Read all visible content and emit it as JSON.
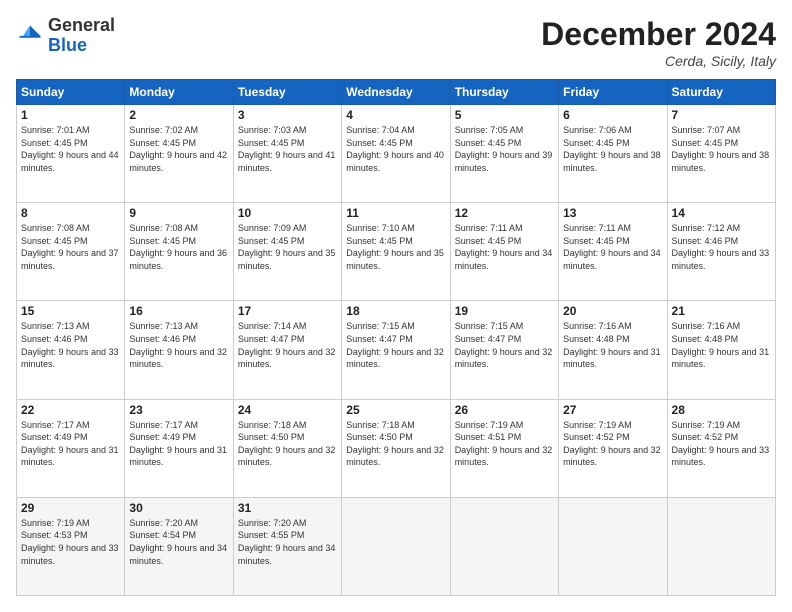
{
  "header": {
    "logo": {
      "general": "General",
      "blue": "Blue"
    },
    "title": "December 2024",
    "location": "Cerda, Sicily, Italy"
  },
  "weekdays": [
    "Sunday",
    "Monday",
    "Tuesday",
    "Wednesday",
    "Thursday",
    "Friday",
    "Saturday"
  ],
  "weeks": [
    [
      {
        "day": "1",
        "sunrise": "Sunrise: 7:01 AM",
        "sunset": "Sunset: 4:45 PM",
        "daylight": "Daylight: 9 hours and 44 minutes."
      },
      {
        "day": "2",
        "sunrise": "Sunrise: 7:02 AM",
        "sunset": "Sunset: 4:45 PM",
        "daylight": "Daylight: 9 hours and 42 minutes."
      },
      {
        "day": "3",
        "sunrise": "Sunrise: 7:03 AM",
        "sunset": "Sunset: 4:45 PM",
        "daylight": "Daylight: 9 hours and 41 minutes."
      },
      {
        "day": "4",
        "sunrise": "Sunrise: 7:04 AM",
        "sunset": "Sunset: 4:45 PM",
        "daylight": "Daylight: 9 hours and 40 minutes."
      },
      {
        "day": "5",
        "sunrise": "Sunrise: 7:05 AM",
        "sunset": "Sunset: 4:45 PM",
        "daylight": "Daylight: 9 hours and 39 minutes."
      },
      {
        "day": "6",
        "sunrise": "Sunrise: 7:06 AM",
        "sunset": "Sunset: 4:45 PM",
        "daylight": "Daylight: 9 hours and 38 minutes."
      },
      {
        "day": "7",
        "sunrise": "Sunrise: 7:07 AM",
        "sunset": "Sunset: 4:45 PM",
        "daylight": "Daylight: 9 hours and 38 minutes."
      }
    ],
    [
      {
        "day": "8",
        "sunrise": "Sunrise: 7:08 AM",
        "sunset": "Sunset: 4:45 PM",
        "daylight": "Daylight: 9 hours and 37 minutes."
      },
      {
        "day": "9",
        "sunrise": "Sunrise: 7:08 AM",
        "sunset": "Sunset: 4:45 PM",
        "daylight": "Daylight: 9 hours and 36 minutes."
      },
      {
        "day": "10",
        "sunrise": "Sunrise: 7:09 AM",
        "sunset": "Sunset: 4:45 PM",
        "daylight": "Daylight: 9 hours and 35 minutes."
      },
      {
        "day": "11",
        "sunrise": "Sunrise: 7:10 AM",
        "sunset": "Sunset: 4:45 PM",
        "daylight": "Daylight: 9 hours and 35 minutes."
      },
      {
        "day": "12",
        "sunrise": "Sunrise: 7:11 AM",
        "sunset": "Sunset: 4:45 PM",
        "daylight": "Daylight: 9 hours and 34 minutes."
      },
      {
        "day": "13",
        "sunrise": "Sunrise: 7:11 AM",
        "sunset": "Sunset: 4:45 PM",
        "daylight": "Daylight: 9 hours and 34 minutes."
      },
      {
        "day": "14",
        "sunrise": "Sunrise: 7:12 AM",
        "sunset": "Sunset: 4:46 PM",
        "daylight": "Daylight: 9 hours and 33 minutes."
      }
    ],
    [
      {
        "day": "15",
        "sunrise": "Sunrise: 7:13 AM",
        "sunset": "Sunset: 4:46 PM",
        "daylight": "Daylight: 9 hours and 33 minutes."
      },
      {
        "day": "16",
        "sunrise": "Sunrise: 7:13 AM",
        "sunset": "Sunset: 4:46 PM",
        "daylight": "Daylight: 9 hours and 32 minutes."
      },
      {
        "day": "17",
        "sunrise": "Sunrise: 7:14 AM",
        "sunset": "Sunset: 4:47 PM",
        "daylight": "Daylight: 9 hours and 32 minutes."
      },
      {
        "day": "18",
        "sunrise": "Sunrise: 7:15 AM",
        "sunset": "Sunset: 4:47 PM",
        "daylight": "Daylight: 9 hours and 32 minutes."
      },
      {
        "day": "19",
        "sunrise": "Sunrise: 7:15 AM",
        "sunset": "Sunset: 4:47 PM",
        "daylight": "Daylight: 9 hours and 32 minutes."
      },
      {
        "day": "20",
        "sunrise": "Sunrise: 7:16 AM",
        "sunset": "Sunset: 4:48 PM",
        "daylight": "Daylight: 9 hours and 31 minutes."
      },
      {
        "day": "21",
        "sunrise": "Sunrise: 7:16 AM",
        "sunset": "Sunset: 4:48 PM",
        "daylight": "Daylight: 9 hours and 31 minutes."
      }
    ],
    [
      {
        "day": "22",
        "sunrise": "Sunrise: 7:17 AM",
        "sunset": "Sunset: 4:49 PM",
        "daylight": "Daylight: 9 hours and 31 minutes."
      },
      {
        "day": "23",
        "sunrise": "Sunrise: 7:17 AM",
        "sunset": "Sunset: 4:49 PM",
        "daylight": "Daylight: 9 hours and 31 minutes."
      },
      {
        "day": "24",
        "sunrise": "Sunrise: 7:18 AM",
        "sunset": "Sunset: 4:50 PM",
        "daylight": "Daylight: 9 hours and 32 minutes."
      },
      {
        "day": "25",
        "sunrise": "Sunrise: 7:18 AM",
        "sunset": "Sunset: 4:50 PM",
        "daylight": "Daylight: 9 hours and 32 minutes."
      },
      {
        "day": "26",
        "sunrise": "Sunrise: 7:19 AM",
        "sunset": "Sunset: 4:51 PM",
        "daylight": "Daylight: 9 hours and 32 minutes."
      },
      {
        "day": "27",
        "sunrise": "Sunrise: 7:19 AM",
        "sunset": "Sunset: 4:52 PM",
        "daylight": "Daylight: 9 hours and 32 minutes."
      },
      {
        "day": "28",
        "sunrise": "Sunrise: 7:19 AM",
        "sunset": "Sunset: 4:52 PM",
        "daylight": "Daylight: 9 hours and 33 minutes."
      }
    ],
    [
      {
        "day": "29",
        "sunrise": "Sunrise: 7:19 AM",
        "sunset": "Sunset: 4:53 PM",
        "daylight": "Daylight: 9 hours and 33 minutes."
      },
      {
        "day": "30",
        "sunrise": "Sunrise: 7:20 AM",
        "sunset": "Sunset: 4:54 PM",
        "daylight": "Daylight: 9 hours and 34 minutes."
      },
      {
        "day": "31",
        "sunrise": "Sunrise: 7:20 AM",
        "sunset": "Sunset: 4:55 PM",
        "daylight": "Daylight: 9 hours and 34 minutes."
      },
      null,
      null,
      null,
      null
    ]
  ]
}
